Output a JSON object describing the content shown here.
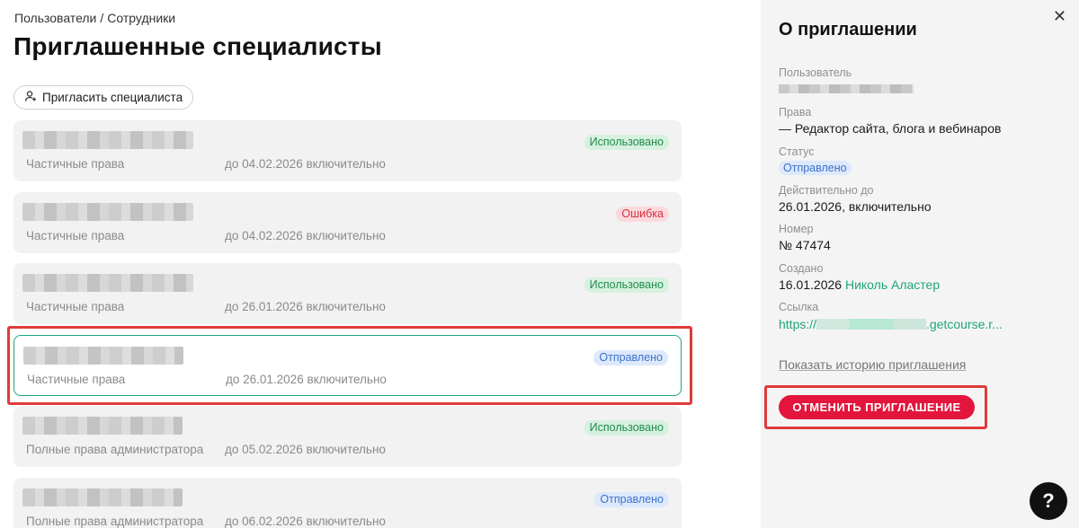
{
  "breadcrumb": {
    "root": "Пользователи",
    "separator": "/",
    "current": "Сотрудники"
  },
  "page_title": "Приглашенные специалисты",
  "invite_button": {
    "label": "Пригласить специалиста",
    "icon": "add-user-icon"
  },
  "invitations": [
    {
      "rights": "Частичные права",
      "until": "до 04.02.2026 включительно",
      "status": "Использовано",
      "status_type": "used"
    },
    {
      "rights": "Частичные права",
      "until": "до 04.02.2026 включительно",
      "status": "Ошибка",
      "status_type": "error"
    },
    {
      "rights": "Частичные права",
      "until": "до 26.01.2026 включительно",
      "status": "Использовано",
      "status_type": "used"
    },
    {
      "rights": "Частичные права",
      "until": "до 26.01.2026 включительно",
      "status": "Отправлено",
      "status_type": "sent"
    },
    {
      "rights": "Полные права администратора",
      "until": "до 05.02.2026 включительно",
      "status": "Использовано",
      "status_type": "used"
    },
    {
      "rights": "Полные права администратора",
      "until": "до 06.02.2026 включительно",
      "status": "Отправлено",
      "status_type": "sent"
    }
  ],
  "panel": {
    "title": "О приглашении",
    "close_icon": "close-icon",
    "user_label": "Пользователь",
    "rights_label": "Права",
    "rights_value": "— Редактор сайта, блога и вебинаров",
    "status_label": "Статус",
    "status_value": "Отправлено",
    "valid_label": "Действительно до",
    "valid_value": "26.01.2026, включительно",
    "number_label": "Номер",
    "number_value": "№ 47474",
    "created_label": "Создано",
    "created_date": "16.01.2026",
    "created_by": "Николь Аластер",
    "link_label": "Ссылка",
    "link_prefix": "https://",
    "link_suffix": ".getcourse.r...",
    "history_link": "Показать историю приглашения",
    "cancel_button": "ОТМЕНИТЬ ПРИГЛАШЕНИЕ"
  },
  "help_button": "?",
  "colors": {
    "accent_green": "#1fa67a",
    "danger_red": "#e3153d",
    "highlight_red": "#e03a3a",
    "badge_used": "#1f8b4c",
    "badge_error": "#d32f3f",
    "badge_sent": "#3c73c9"
  }
}
